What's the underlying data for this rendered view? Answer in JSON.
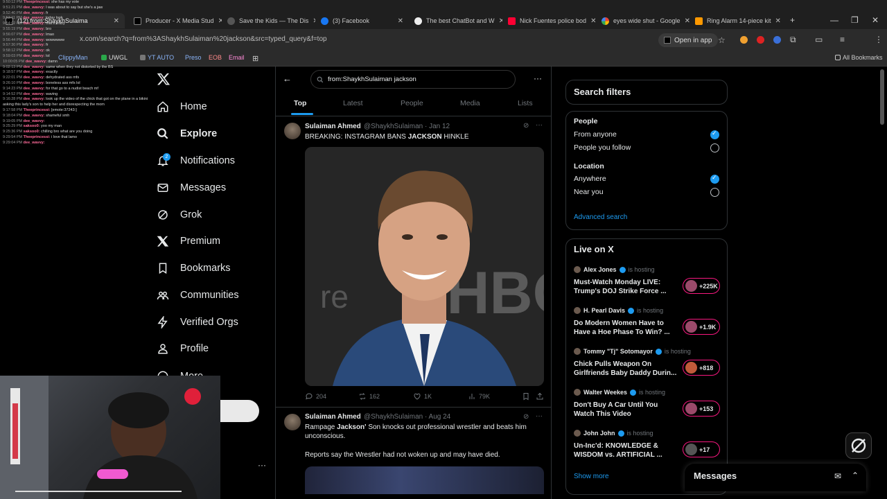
{
  "browser": {
    "tabs": [
      {
        "label": "(12) from:ShaykhSulaima",
        "active": true
      },
      {
        "label": "Producer - X Media Stud"
      },
      {
        "label": "Save the Kids — The Dis"
      },
      {
        "label": "(3) Facebook"
      },
      {
        "label": "The best ChatBot and W"
      },
      {
        "label": "Nick Fuentes police bod"
      },
      {
        "label": "eyes wide shut - Google"
      },
      {
        "label": "Ring Alarm 14-piece kit"
      }
    ],
    "url": "x.com/search?q=from%3AShaykhSulaiman%20jackson&src=typed_query&f=top",
    "open_in_app": "Open in app",
    "bookmarks": [
      "ClippyMan",
      "UWGL",
      "YT AUTO",
      "Preso",
      "EOB",
      "Email"
    ],
    "all_bookmarks": "All Bookmarks"
  },
  "nav": {
    "items": [
      "Home",
      "Explore",
      "Notifications",
      "Messages",
      "Grok",
      "Premium",
      "Bookmarks",
      "Communities",
      "Verified Orgs",
      "Profile",
      "More"
    ],
    "notifications_badge": "2"
  },
  "search": {
    "query": "from:ShaykhSulaiman jackson",
    "tabs": [
      "Top",
      "Latest",
      "People",
      "Media",
      "Lists"
    ]
  },
  "tweets": [
    {
      "name": "Sulaiman Ahmed",
      "handle": "@ShaykhSulaiman · Jan 12",
      "text_pre": "BREAKING: INSTAGRAM BANS ",
      "text_bold": "JACKSON",
      "text_post": " HINKLE",
      "image_label": "HBO",
      "replies": "204",
      "reposts": "162",
      "likes": "1K",
      "views": "79K"
    },
    {
      "name": "Sulaiman Ahmed",
      "handle": "@ShaykhSulaiman · Aug 24",
      "text_pre": "Rampage ",
      "text_bold": "Jackson'",
      "text_post": " Son knocks out professional wrestler and beats him unconscious.",
      "text_2": "Reports say the Wrestler had not woken up and may have died."
    }
  ],
  "filters": {
    "title": "Search filters",
    "people_heading": "People",
    "people_opts": [
      "From anyone",
      "People you follow"
    ],
    "location_heading": "Location",
    "location_opts": [
      "Anywhere",
      "Near you"
    ],
    "advanced": "Advanced search"
  },
  "live": {
    "title": "Live on X",
    "is_hosting": "is hosting",
    "items": [
      {
        "host": "Alex Jones",
        "title": "Must-Watch Monday LIVE: Trump's DOJ Strike Force ...",
        "count": "+225K"
      },
      {
        "host": "H. Pearl Davis",
        "title": "Do Modern Women Have to Have a Hoe Phase To Win? ...",
        "count": "+1.9K"
      },
      {
        "host": "Tommy \"Tj\" Sotomayor",
        "title": "Chick Pulls Weapon On Girlfriends Baby Daddy Durin...",
        "count": "+818"
      },
      {
        "host": "Walter Weekes",
        "title": "Don't Buy A Car Until You Watch This Video",
        "count": "+153"
      },
      {
        "host": "John John",
        "title": "Un-Inc'd: KNOWLEDGE & WISDOM vs. ARTIFICIAL ...",
        "count": "+17"
      }
    ],
    "show_more": "Show more"
  },
  "messages_dock": "Messages",
  "chat": [
    {
      "t": "9:50:12 PM",
      "u": "Theeprincessi",
      "m": "she has my vote"
    },
    {
      "t": "9:51:21 PM",
      "u": "dee_wavvy",
      "m": "I was about to say but she's a jaw"
    },
    {
      "t": "9:52:40 PM",
      "u": "dee_wavvy",
      "m": "fr"
    },
    {
      "t": "9:53:11 PM",
      "u": "dee_wavvy",
      "m": "today look"
    },
    {
      "t": "9:54:02 PM",
      "u": "dee_wavvy",
      "m": "that's crazy"
    },
    {
      "t": "9:55:19 PM",
      "u": "dee_wavvy",
      "m": "bro"
    },
    {
      "t": "9:56:07 PM",
      "u": "dee_wavvy",
      "m": "lmao"
    },
    {
      "t": "9:56:44 PM",
      "u": "dee_wavvy",
      "m": "wowwwww"
    },
    {
      "t": "9:57:30 PM",
      "u": "dee_wavvy",
      "m": "fr"
    },
    {
      "t": "9:58:12 PM",
      "u": "dee_wavvy",
      "m": "ok"
    },
    {
      "t": "9:59:03 PM",
      "u": "dee_wavvy",
      "m": "lol"
    },
    {
      "t": "10:00:05 PM",
      "u": "dee_wavvy",
      "m": "damn"
    },
    {
      "t": "9:02:13 PM",
      "u": "dee_wavvy",
      "m": "same when they not distorted by the BS"
    },
    {
      "t": "9:18:57 PM",
      "u": "dee_wavvy",
      "m": "exactly"
    },
    {
      "t": "9:22:01 PM",
      "u": "dee_wavvy",
      "m": "dehydrated ass mfs"
    },
    {
      "t": "9:26:10 PM",
      "u": "dee_wavvy",
      "m": "boneless ass mfs lol"
    },
    {
      "t": "9:14:23 PM",
      "u": "dee_wavvy",
      "m": "for that go to a nudist beach mf"
    },
    {
      "t": "9:14:52 PM",
      "u": "dee_wavvy",
      "m": "waving"
    },
    {
      "t": "9:16:28 PM",
      "u": "dee_wavvy",
      "m": "look up the video of the chick that got on the plane in a bikini"
    },
    {
      "t": "",
      "u": "",
      "m": "asking this lady's son to help her and disrespecting the mom"
    },
    {
      "t": "9:17:58 PM",
      "u": "Theeprincessi",
      "m": "[emote:37243:]"
    },
    {
      "t": "9:18:04 PM",
      "u": "dee_wavvy",
      "m": "shameful smh"
    },
    {
      "t": "9:19:05 PM",
      "u": "dee_wavvy",
      "m": ""
    },
    {
      "t": "9:25:29 PM",
      "u": "saksoo0",
      "m": "yoo my man"
    },
    {
      "t": "9:25:36 PM",
      "u": "saksoo0",
      "m": "chilling bro what are you doing"
    },
    {
      "t": "9:29:54 PM",
      "u": "Theeprincessi",
      "m": "i love that lamo"
    },
    {
      "t": "9:29:04 PM",
      "u": "dee_wavvy",
      "m": ""
    }
  ]
}
